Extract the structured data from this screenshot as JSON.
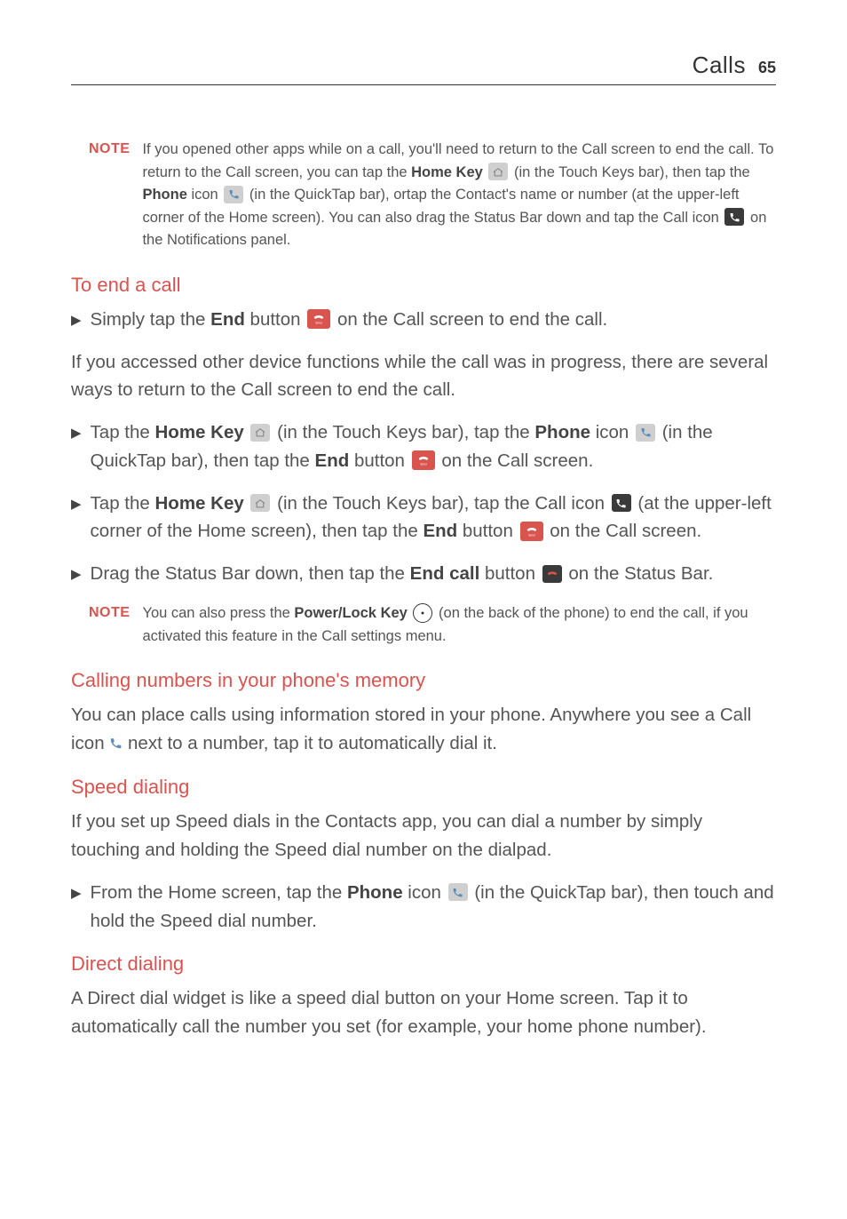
{
  "header": {
    "title": "Calls",
    "page_number": "65"
  },
  "note1": {
    "label": "NOTE",
    "t1": "If you opened other apps while on a call, you'll need to return to the Call screen to end the call. To return to the Call screen, you can tap the ",
    "home_key": "Home Key",
    "t2": " (in the Touch Keys bar), then tap the ",
    "phone": "Phone",
    "t3": " icon ",
    "t4": " (in the QuickTap bar), ortap the Contact's name or number (at the upper-left corner of the Home screen). You can also drag the Status Bar down and tap the Call icon ",
    "t5": " on the Notifications panel."
  },
  "sec_end": {
    "heading": "To end a call",
    "b1_a": "Simply tap the ",
    "b1_end": "End",
    "b1_b": " button ",
    "b1_c": " on the Call screen to end the call.",
    "para": "If you accessed other device functions while the call was in progress, there are several ways to return to the Call screen to end the call.",
    "b2_a": "Tap the ",
    "b2_hk": "Home Key",
    "b2_b": " (in the Touch Keys bar), tap the ",
    "b2_phone": "Phone",
    "b2_c": " icon ",
    "b2_d": " (in the QuickTap bar), then tap the ",
    "b2_end": "End",
    "b2_e": " button ",
    "b2_f": " on the Call screen.",
    "b3_a": "Tap the ",
    "b3_hk": "Home Key",
    "b3_b": " (in the Touch Keys bar), tap the Call icon ",
    "b3_c": " (at the upper-left corner of the Home screen), then tap the ",
    "b3_end": "End",
    "b3_d": " button ",
    "b3_e": " on the Call screen.",
    "b4_a": "Drag the Status Bar down, then tap the ",
    "b4_ec": "End call",
    "b4_b": " button ",
    "b4_c": " on the Status Bar."
  },
  "note2": {
    "label": "NOTE",
    "t1": "You can also press the ",
    "plk": "Power/Lock Key",
    "t2": " (on the back of the phone) to end the call, if you activated this feature in the Call settings menu."
  },
  "sec_memory": {
    "heading": "Calling numbers in your phone's memory",
    "p1": "You can place calls using information stored in your phone. Anywhere you see a Call icon ",
    "p2": " next to a number, tap it to automatically dial it."
  },
  "sec_speed": {
    "heading": "Speed dialing",
    "para": "If you set up Speed dials in the Contacts app, you can dial a number by simply touching and holding the Speed dial number on the dialpad.",
    "b1_a": "From the Home screen, tap the ",
    "b1_phone": "Phone",
    "b1_b": " icon ",
    "b1_c": " (in the QuickTap bar), then touch and hold the Speed dial number."
  },
  "sec_direct": {
    "heading": "Direct dialing",
    "para": "A Direct dial widget is like a speed dial button on your Home screen. Tap it to automatically call the number you set (for example, your home phone number)."
  }
}
